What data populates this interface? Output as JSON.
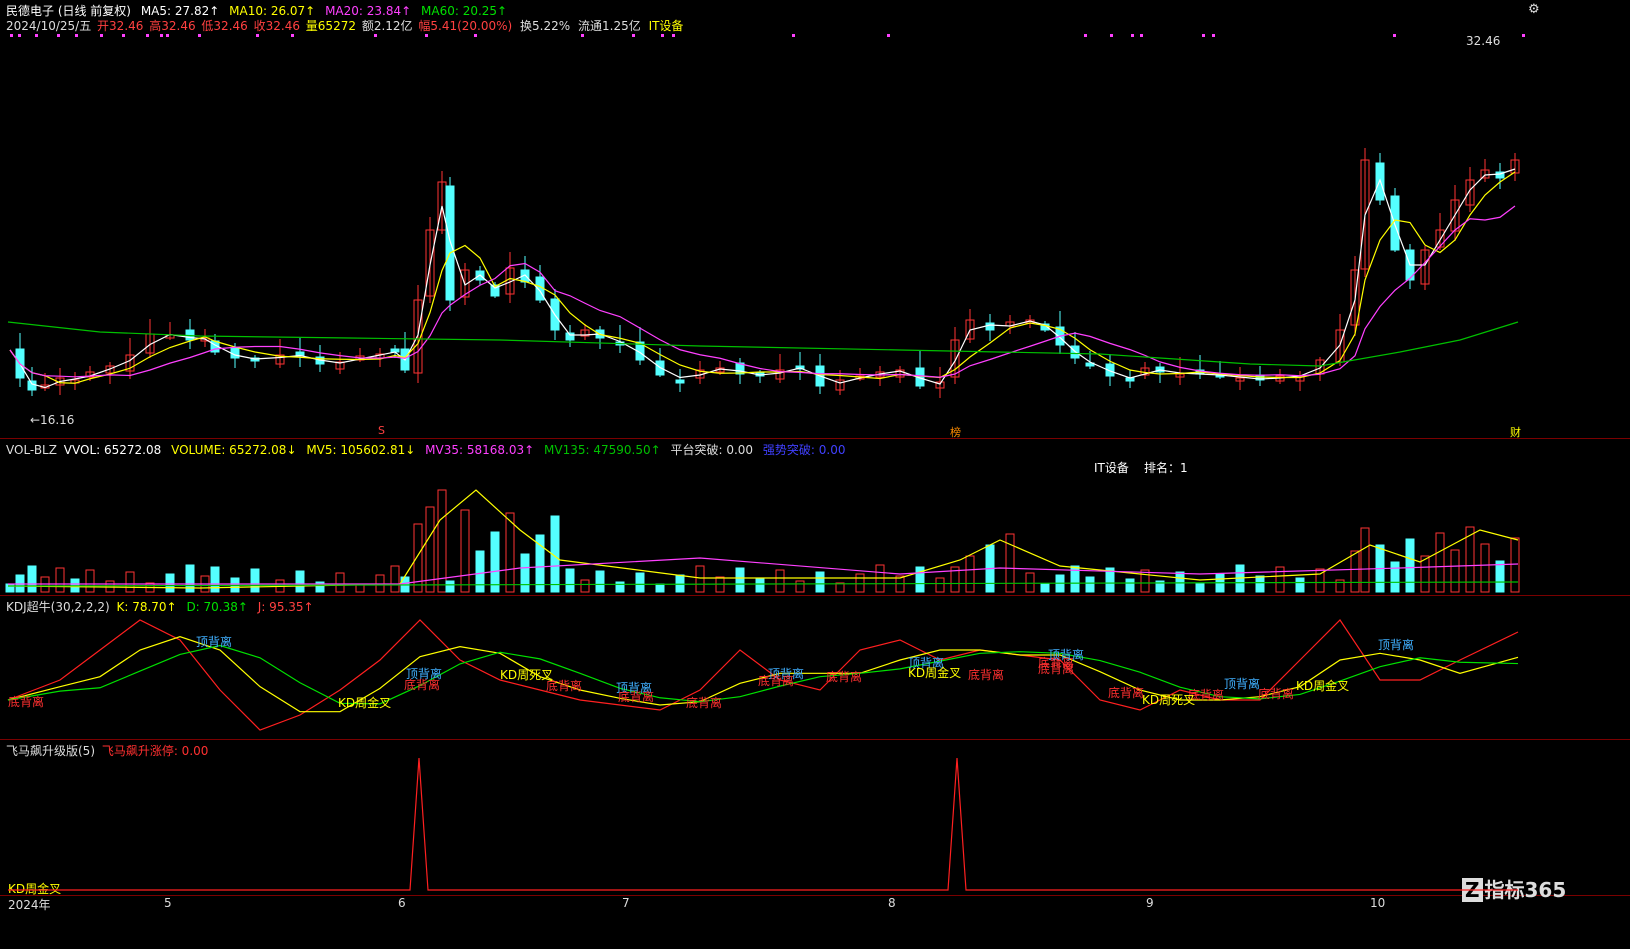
{
  "header": {
    "stock": "民德电子 (日线 前复权)",
    "ma5": "MA5: 27.82↑",
    "ma10": "MA10: 26.07↑",
    "ma20": "MA20: 23.84↑",
    "ma60": "MA60: 20.25↑",
    "date": "2024/10/25/五",
    "open": "开32.46",
    "high": "高32.46",
    "low": "低32.46",
    "close": "收32.46",
    "vol": "量65272",
    "amount": "额2.12亿",
    "change": "幅5.41(20.00%)",
    "turnover": "换5.22%",
    "float": "流通1.25亿",
    "sector": "IT设备"
  },
  "price": {
    "last": "32.46",
    "low_mark": "←16.16",
    "tags": [
      "S",
      "榜",
      "财"
    ]
  },
  "vol_panel": {
    "name": "VOL-BLZ",
    "vvol": "VVOL: 65272.08",
    "volume": "VOLUME: 65272.08↓",
    "mv5": "MV5: 105602.81↓",
    "mv35": "MV35: 58168.03↑",
    "mv135": "MV135: 47590.50↑",
    "platform": "平台突破: 0.00",
    "strong": "强势突破: 0.00",
    "rank_sector": "IT设备",
    "rank": "排名：1"
  },
  "kdj_panel": {
    "name": "KDJ超牛(30,2,2,2)",
    "k": "K: 78.70↑",
    "d": "D: 70.38↑",
    "j": "J: 95.35↑",
    "labels": [
      "顶背离",
      "顶背离",
      "底背离",
      "KD周死叉",
      "底背离",
      "顶背离",
      "底背离",
      "KD周金叉",
      "底背离",
      "顶背离",
      "底背离",
      "底背离",
      "顶背离",
      "底背离",
      "KD周金叉",
      "底背离",
      "顶背离",
      "底背离",
      "底背离",
      "KD周死叉",
      "底背离",
      "顶背离",
      "底背离",
      "KD周金叉",
      "顶背离",
      "底背离"
    ]
  },
  "fm_panel": {
    "name": "飞马飙升级版(5)",
    "zt": "飞马飙升涨停: 0.00",
    "bottom_label": "KD周金叉"
  },
  "xaxis": {
    "labels": [
      "2024年",
      "5",
      "6",
      "7",
      "8",
      "9",
      "10"
    ]
  },
  "logo": "指标365",
  "colors": {
    "up": "#ff3333",
    "down": "#54ffff",
    "ma5": "#ffffff",
    "ma10": "#ffff00",
    "ma20": "#ff40ff",
    "ma60": "#00c000"
  }
}
